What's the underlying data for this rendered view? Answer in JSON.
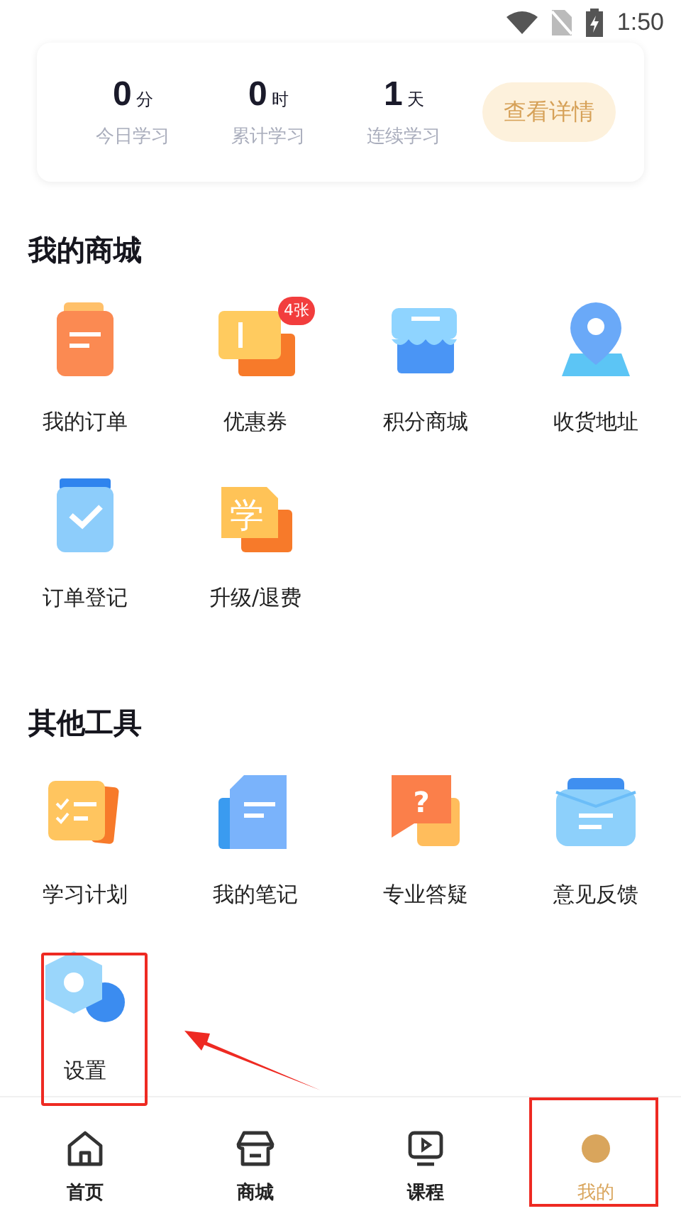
{
  "status_bar": {
    "time": "1:50"
  },
  "stats": [
    {
      "value": "0",
      "unit": "分",
      "label": "今日学习"
    },
    {
      "value": "0",
      "unit": "时",
      "label": "累计学习"
    },
    {
      "value": "1",
      "unit": "天",
      "label": "连续学习"
    }
  ],
  "details_button": "查看详情",
  "sections": [
    {
      "title": "我的商城",
      "items": [
        {
          "label": "我的订单",
          "highlighted": false
        },
        {
          "label": "优惠券",
          "badge": "4张",
          "highlighted": false
        },
        {
          "label": "积分商城",
          "highlighted": false
        },
        {
          "label": "收货地址",
          "highlighted": false
        },
        {
          "label": "订单登记",
          "highlighted": false
        },
        {
          "label": "升级/退费",
          "icon_text": "学",
          "highlighted": false
        }
      ]
    },
    {
      "title": "其他工具",
      "items": [
        {
          "label": "学习计划",
          "highlighted": false
        },
        {
          "label": "我的笔记",
          "highlighted": false
        },
        {
          "label": "专业答疑",
          "icon_text": "?",
          "highlighted": false
        },
        {
          "label": "意见反馈",
          "highlighted": false
        },
        {
          "label": "设置",
          "highlighted": true
        }
      ]
    }
  ],
  "nav": [
    {
      "label": "首页",
      "selected": false,
      "highlighted": false
    },
    {
      "label": "商城",
      "selected": false,
      "highlighted": false
    },
    {
      "label": "课程",
      "selected": false,
      "highlighted": false
    },
    {
      "label": "我的",
      "selected": true,
      "highlighted": true
    }
  ]
}
